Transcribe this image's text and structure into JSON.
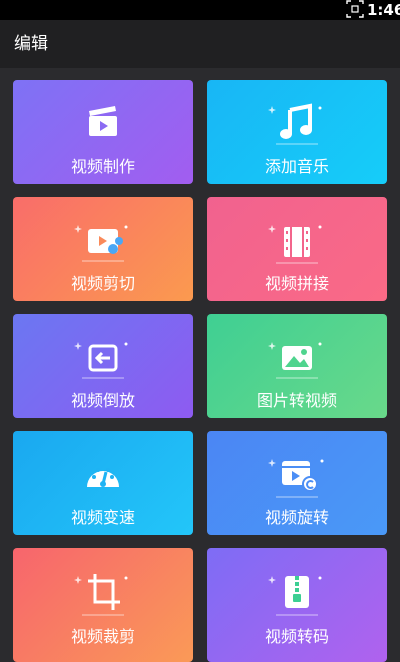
{
  "status_bar": {
    "time": "1:46",
    "screenshot_icon": "screenshot-icon"
  },
  "app_bar": {
    "title": "编辑"
  },
  "tiles": [
    {
      "label": "视频制作",
      "icon": "clapperboard-icon",
      "color": "#7e72f5"
    },
    {
      "label": "添加音乐",
      "icon": "music-note-icon",
      "color": "#18b6f5"
    },
    {
      "label": "视频剪切",
      "icon": "video-scissors-icon",
      "color": "#f96d6a"
    },
    {
      "label": "视频拼接",
      "icon": "film-strip-icon",
      "color": "#f1628f"
    },
    {
      "label": "视频倒放",
      "icon": "reverse-play-icon",
      "color": "#6b77f2"
    },
    {
      "label": "图片转视频",
      "icon": "image-icon",
      "color": "#3fcf93"
    },
    {
      "label": "视频变速",
      "icon": "speedometer-icon",
      "color": "#1aa8f0"
    },
    {
      "label": "视频旋转",
      "icon": "video-rotate-icon",
      "color": "#4b86f4"
    },
    {
      "label": "视频裁剪",
      "icon": "crop-icon",
      "color": "#f7656d"
    },
    {
      "label": "视频转码",
      "icon": "zip-file-icon",
      "color": "#7e6cf5"
    }
  ]
}
